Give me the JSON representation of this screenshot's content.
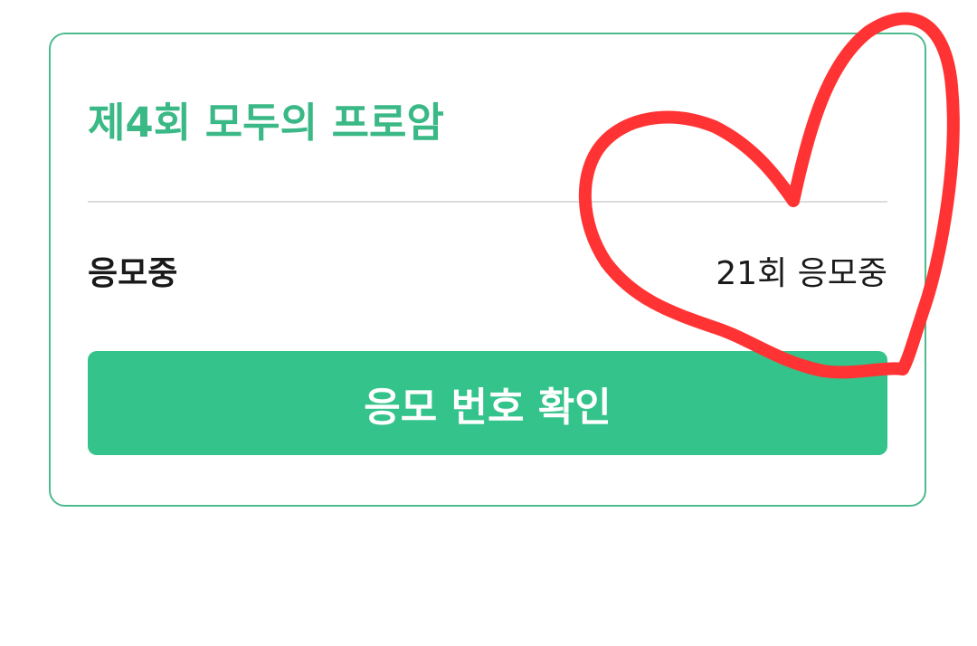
{
  "card": {
    "title": "제4회 모두의 프로암",
    "status_label": "응모중",
    "status_value": "21회 응모중",
    "button_label": "응모 번호 확인"
  },
  "colors": {
    "accent": "#34c38a",
    "title": "#3ab886",
    "border": "#4dbb8e",
    "divider": "#dcdcdc",
    "annotation": "#ff3333"
  },
  "annotation": {
    "icon": "heart-icon"
  }
}
